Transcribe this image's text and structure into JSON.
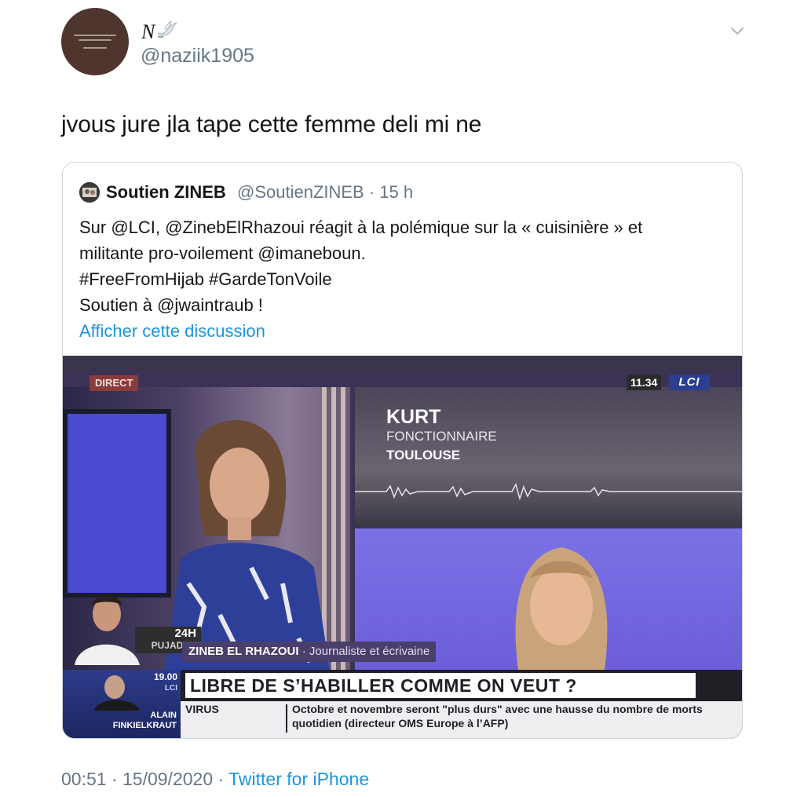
{
  "author": {
    "display_name": "N",
    "handle": "@naziik1905",
    "avatar_text": ""
  },
  "tweet": {
    "text": "jvous jure jla tape cette femme deli mi ne"
  },
  "quoted": {
    "display_name": "Soutien ZINEB",
    "handle_time": "@SoutienZINEB · 15 h",
    "lines": [
      "Sur @LCI, @ZinebElRhazoui réagit à la polémique sur la « cuisinière » et",
      "militante pro-voilement @imaneboun.",
      "#FreeFromHijab #GardeTonVoile",
      "Soutien à @jwaintraub !"
    ],
    "show_thread": "Afficher cette discussion"
  },
  "video": {
    "direct": "DIRECT",
    "time": "11.34",
    "channel": "LCI",
    "guest_name": "KURT",
    "guest_job": "FONCTIONNAIRE",
    "guest_city": "TOULOUSE",
    "show_top": "24H",
    "show_bottom": "PUJADAS",
    "caption_name": "ZINEB EL RHAZOUI",
    "caption_role": " · Journaliste et écrivaine",
    "next_time": "19.00",
    "next_channel": "LCI",
    "next_guest": "ALAIN FINKIELKRAUT",
    "headline": "LIBRE DE S’HABILLER COMME ON VEUT ?",
    "ticker_label": "VIRUS",
    "ticker_text": "Octobre et novembre seront \"plus durs\" avec une hausse du nombre de morts quotidien (directeur OMS Europe à l’AFP)"
  },
  "footer": {
    "time_date": "00:51 · 15/09/2020 · ",
    "source": "Twitter for iPhone"
  },
  "colors": {
    "link": "#1b95e0",
    "secondary_text": "#657786",
    "border": "#ccd6dd"
  }
}
